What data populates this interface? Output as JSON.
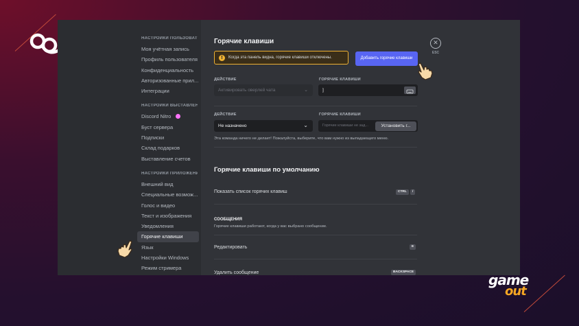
{
  "sidebar": {
    "sections": [
      {
        "heading": "НАСТРОЙКИ ПОЛЬЗОВАТЕ...",
        "items": [
          "Моя учётная запись",
          "Профиль пользователя",
          "Конфиденциальность",
          "Авторизованные прил...",
          "Интеграции"
        ]
      },
      {
        "heading": "НАСТРОЙКИ ВЫСТАВЛЕН...",
        "items": [
          "Discord Nitro",
          "Буст сервера",
          "Подписки",
          "Склад подарков",
          "Выставление счетов"
        ]
      },
      {
        "heading": "НАСТРОЙКИ ПРИЛОЖЕНИЯ",
        "items": [
          "Внешний вид",
          "Специальные возмож...",
          "Голос и видео",
          "Текст и изображения",
          "Уведомления",
          "Горячие клавиши",
          "Язык",
          "Настройки Windows",
          "Режим стримера"
        ]
      }
    ],
    "active_item": "Горячие клавиши"
  },
  "main": {
    "title": "Горячие клавиши",
    "warning_text": "Когда эта панель видна, горячие клавиши отключены.",
    "warning_icon": "!",
    "add_button": "Добавить горячие клавиши",
    "close_icon": "✕",
    "esc_label": "ESC",
    "bind1": {
      "action_label": "ДЕЙСТВИЕ",
      "hotkey_label": "ГОРЯЧИЕ КЛАВИШИ",
      "action_value": "Активировать оверлей чата",
      "hotkey_value": "]"
    },
    "bind2": {
      "action_label": "ДЕЙСТВИЕ",
      "hotkey_label": "ГОРЯЧИЕ КЛАВИШИ",
      "action_value": "Не назначено",
      "hotkey_placeholder": "Горячие клавиши не зад...",
      "set_button": "Установить г...",
      "hint": "Эта команда ничего не делает! Пожалуйста, выберите, что вам нужно из выпадающего меню."
    },
    "defaults_title": "Горячие клавиши по умолчанию",
    "show_list_label": "Показать список горячих клавиш",
    "show_list_keys": [
      "CTRL",
      "/"
    ],
    "messages_heading": "СООБЩЕНИЯ",
    "messages_desc": "Горячие клавиши работают, когда у вас выбрано сообщение.",
    "edit_label": "Редактировать",
    "edit_key": "E",
    "delete_label": "Удалить сообщение",
    "delete_key": "BACKSPACE"
  },
  "colors": {
    "accent": "#5865f2",
    "warning": "#f0b232",
    "hand": "#f7d9a8"
  }
}
